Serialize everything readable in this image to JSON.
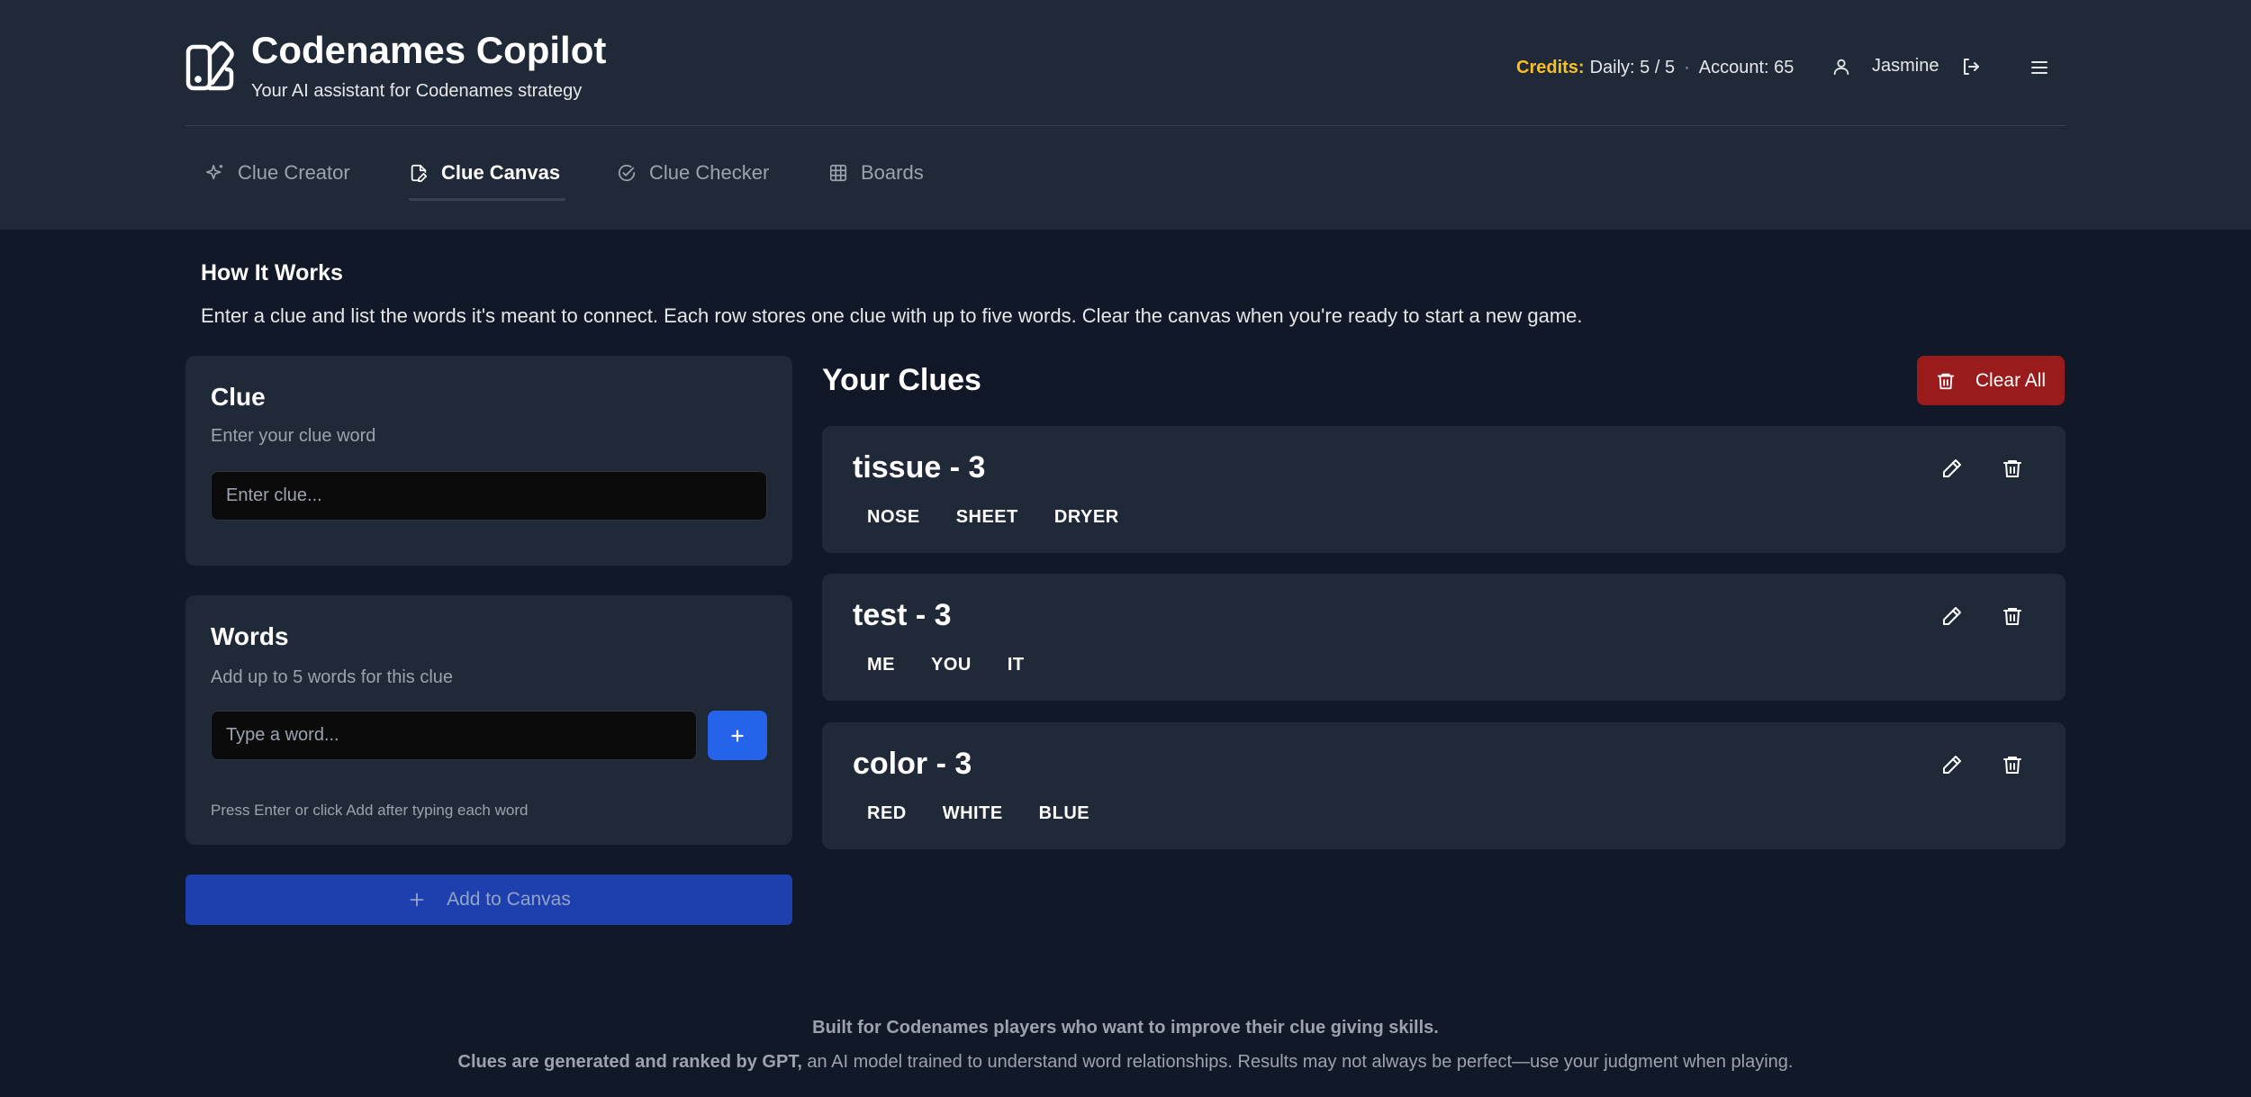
{
  "app": {
    "title": "Codenames Copilot",
    "subtitle": "Your AI assistant for Codenames strategy",
    "logo_icon": "cards-logo-icon"
  },
  "header": {
    "credits_label": "Credits:",
    "credits_daily": "Daily: 5 / 5",
    "credits_separator": "·",
    "credits_account": "Account: 65",
    "user_name": "Jasmine",
    "icons": [
      "user-icon",
      "logout-icon",
      "menu-icon"
    ]
  },
  "tabs": [
    {
      "label": "Clue Creator",
      "icon": "sparkles-icon",
      "active": false
    },
    {
      "label": "Clue Canvas",
      "icon": "file-pen-icon",
      "active": true
    },
    {
      "label": "Clue Checker",
      "icon": "check-circle-icon",
      "active": false
    },
    {
      "label": "Boards",
      "icon": "grid-icon",
      "active": false
    }
  ],
  "how_it_works": {
    "title": "How It Works",
    "text": "Enter a clue and list the words it's meant to connect. Each row stores one clue with up to five words. Clear the canvas when you're ready to start a new game."
  },
  "clue_form": {
    "title": "Clue",
    "description": "Enter your clue word",
    "value": "",
    "placeholder": "Enter clue..."
  },
  "words_form": {
    "title": "Words",
    "description": "Add up to 5 words for this clue",
    "value": "",
    "placeholder": "Type a word...",
    "add_button_icon": "plus-icon",
    "hint": "Press Enter or click Add after typing each word"
  },
  "add_to_canvas": {
    "label": "Add to Canvas",
    "icon": "plus-icon"
  },
  "clues_panel": {
    "title": "Your Clues",
    "clear_all_label": "Clear All",
    "clues": [
      {
        "heading": "tissue - 3",
        "words": [
          "NOSE",
          "SHEET",
          "DRYER"
        ]
      },
      {
        "heading": "test - 3",
        "words": [
          "ME",
          "YOU",
          "IT"
        ]
      },
      {
        "heading": "color - 3",
        "words": [
          "RED",
          "WHITE",
          "BLUE"
        ]
      }
    ]
  },
  "footer": {
    "line1": "Built for Codenames players who want to improve their clue giving skills.",
    "line2_bold": "Clues are generated and ranked by GPT,",
    "line2_rest": " an AI model trained to understand word relationships. Results may not always be perfect—use your judgment when playing."
  },
  "colors": {
    "page_bg": "#111827",
    "panel_bg": "#1f2937",
    "accent_blue": "#2563eb",
    "danger_red": "#991b1b",
    "credits_gold": "#fbbf24"
  }
}
